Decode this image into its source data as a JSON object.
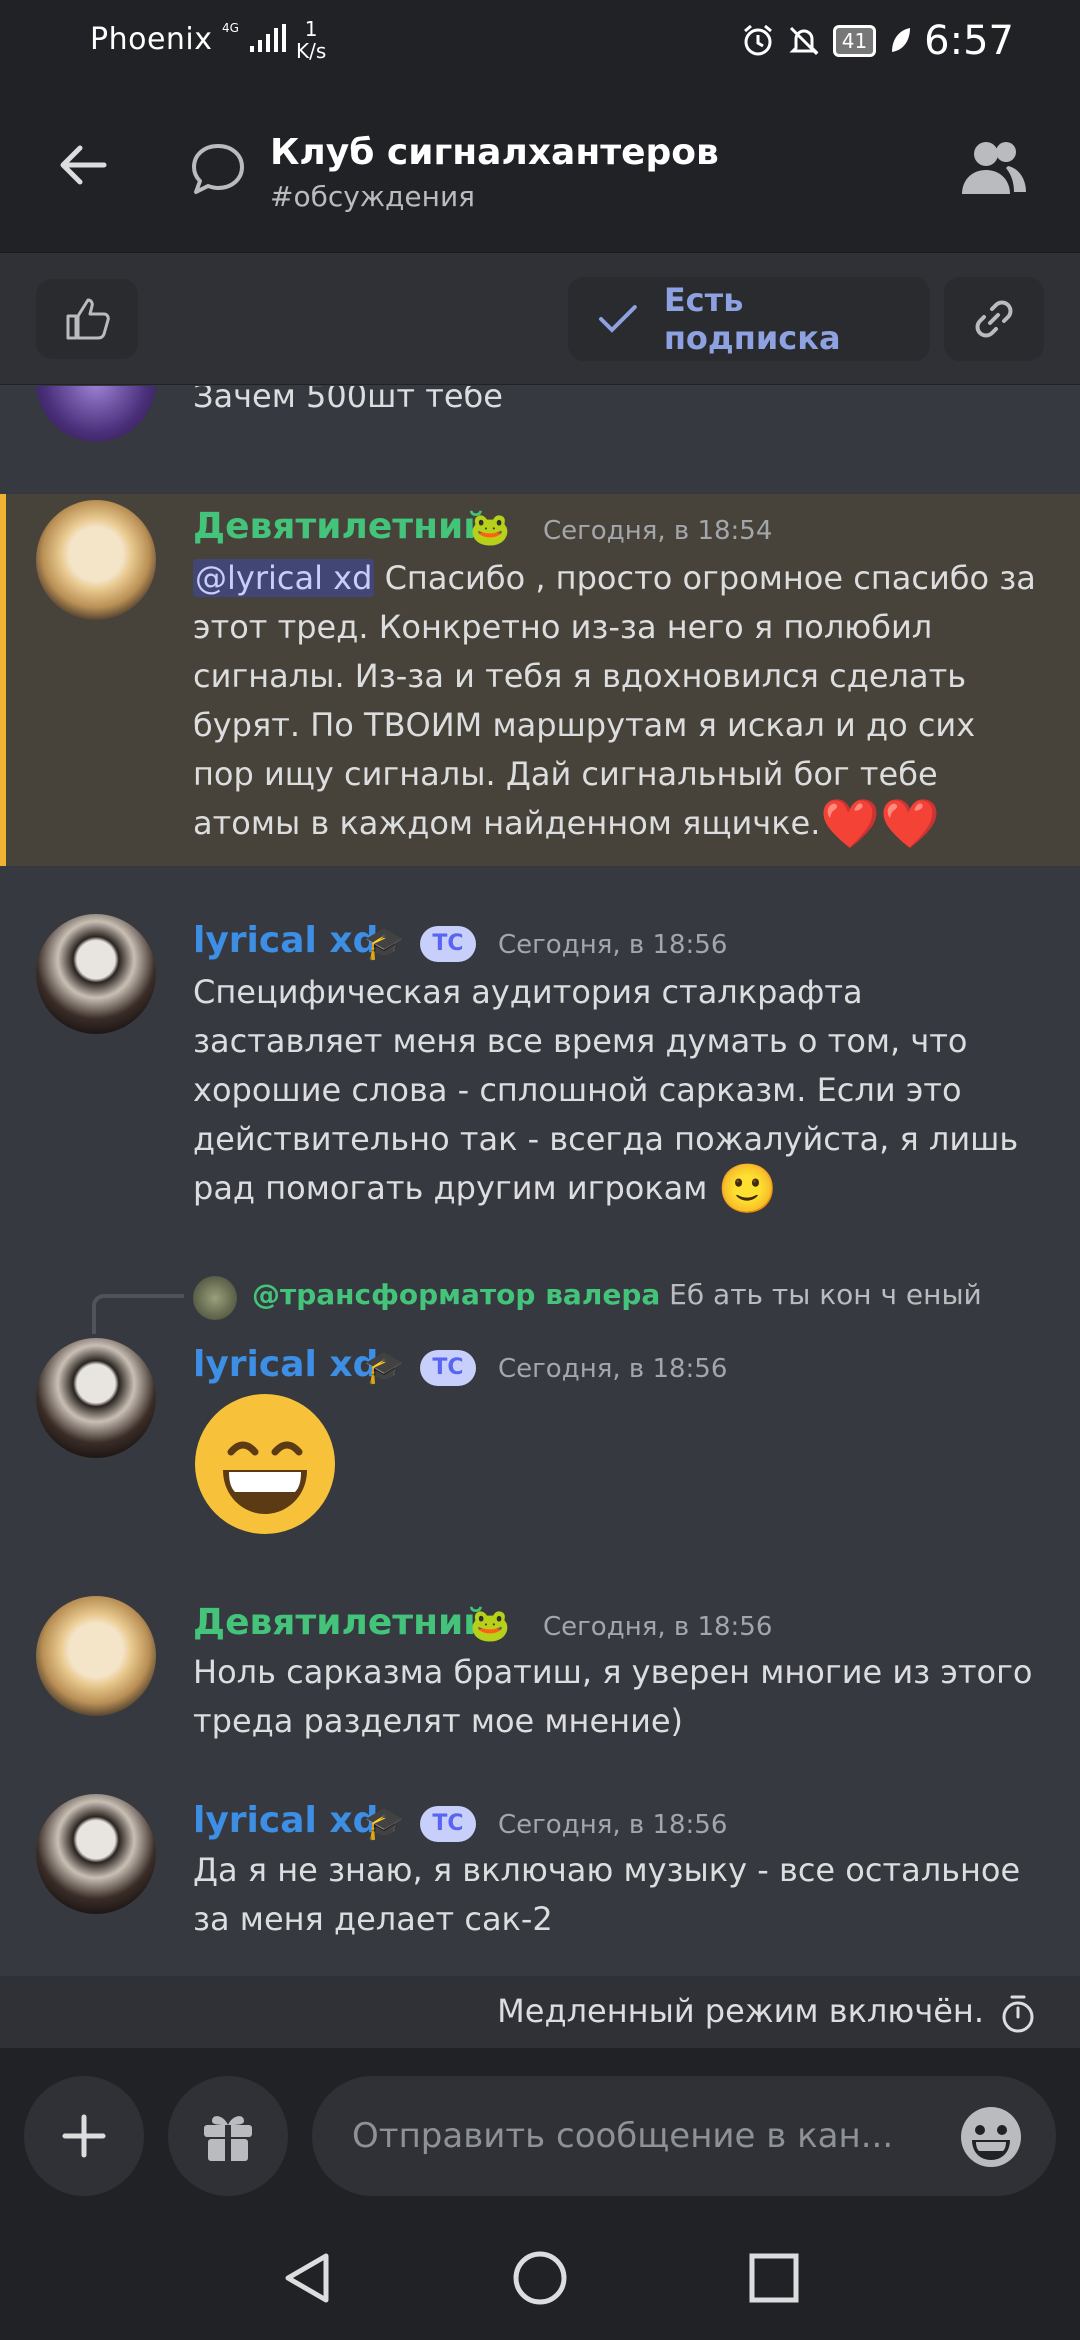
{
  "status_bar": {
    "carrier": "Phoenix",
    "network": "4G",
    "speed_value": "1",
    "speed_unit": "K/s",
    "battery": "41",
    "time": "6:57"
  },
  "header": {
    "title": "Клуб сигналхантеров",
    "channel": "#обсуждения",
    "back_icon": "arrow-left-icon",
    "thread_icon": "speech-bubble-icon",
    "members_icon": "people-icon"
  },
  "actions": {
    "subscribed_label": "Есть подписка",
    "like_icon": "thumbs-up-icon",
    "link_icon": "link-icon"
  },
  "messages": [
    {
      "text": "Зачем 500шт тебе"
    },
    {
      "author": "Девятилетний",
      "author_badge": "🐸",
      "time": "Сегодня, в 18:54",
      "mention": "@lyrical xd",
      "text": " Спасибо , просто огромное спасибо за этот тред. Конкретно из-за него я полюбил сигналы. Из-за  и тебя я вдохновился сделать бурят. По ТВОИМ маршрутам я искал и до сих пор ищу сигналы. Дай сигнальный бог тебе атомы в каждом найденном ящичке.",
      "trailing": "❤️❤️",
      "highlighted": true
    },
    {
      "author": "lyrical xd",
      "author_badge": "🎓",
      "tag": "TC",
      "time": "Сегодня, в 18:56",
      "text": "Специфическая аудитория сталкрафта заставляет меня все время думать о том, что хорошие слова - сплошной сарказм. Если это действительно так - всегда пожалуйста, я лишь рад помогать другим игрокам",
      "trailing": "🙂"
    },
    {
      "reply_to_author": "@трансформатор валера",
      "reply_to_text": "Еб ать ты кон ч еный",
      "author": "lyrical xd",
      "author_badge": "🎓",
      "tag": "TC",
      "time": "Сегодня, в 18:56",
      "big_emoji": "😄"
    },
    {
      "author": "Девятилетний",
      "author_badge": "🐸",
      "time": "Сегодня, в 18:56",
      "text": "Ноль сарказма братиш, я уверен многие из этого треда разделят мое мнение)"
    },
    {
      "author": "lyrical xd",
      "author_badge": "🎓",
      "tag": "TC",
      "time": "Сегодня, в 18:56",
      "text": "Да я не знаю, я включаю музыку - все остальное за меня делает сак-2"
    }
  ],
  "slow_mode": {
    "text": "Медленный режим включён.",
    "icon": "timer-icon"
  },
  "composer": {
    "placeholder": "Отправить сообщение в кан...",
    "plus_icon": "plus-icon",
    "gift_icon": "gift-icon",
    "emoji_icon": "emoji-icon"
  },
  "nav": {
    "back_icon": "triangle-back-icon",
    "home_icon": "circle-home-icon",
    "recent_icon": "square-recent-icon"
  },
  "colors": {
    "background": "#36393f",
    "header": "#202225",
    "accent_blue": "#3d8fe6",
    "accent_green": "#43c47a",
    "highlight": "#48433a",
    "highlight_border": "#f0b232",
    "blurple": "#5865f2"
  }
}
